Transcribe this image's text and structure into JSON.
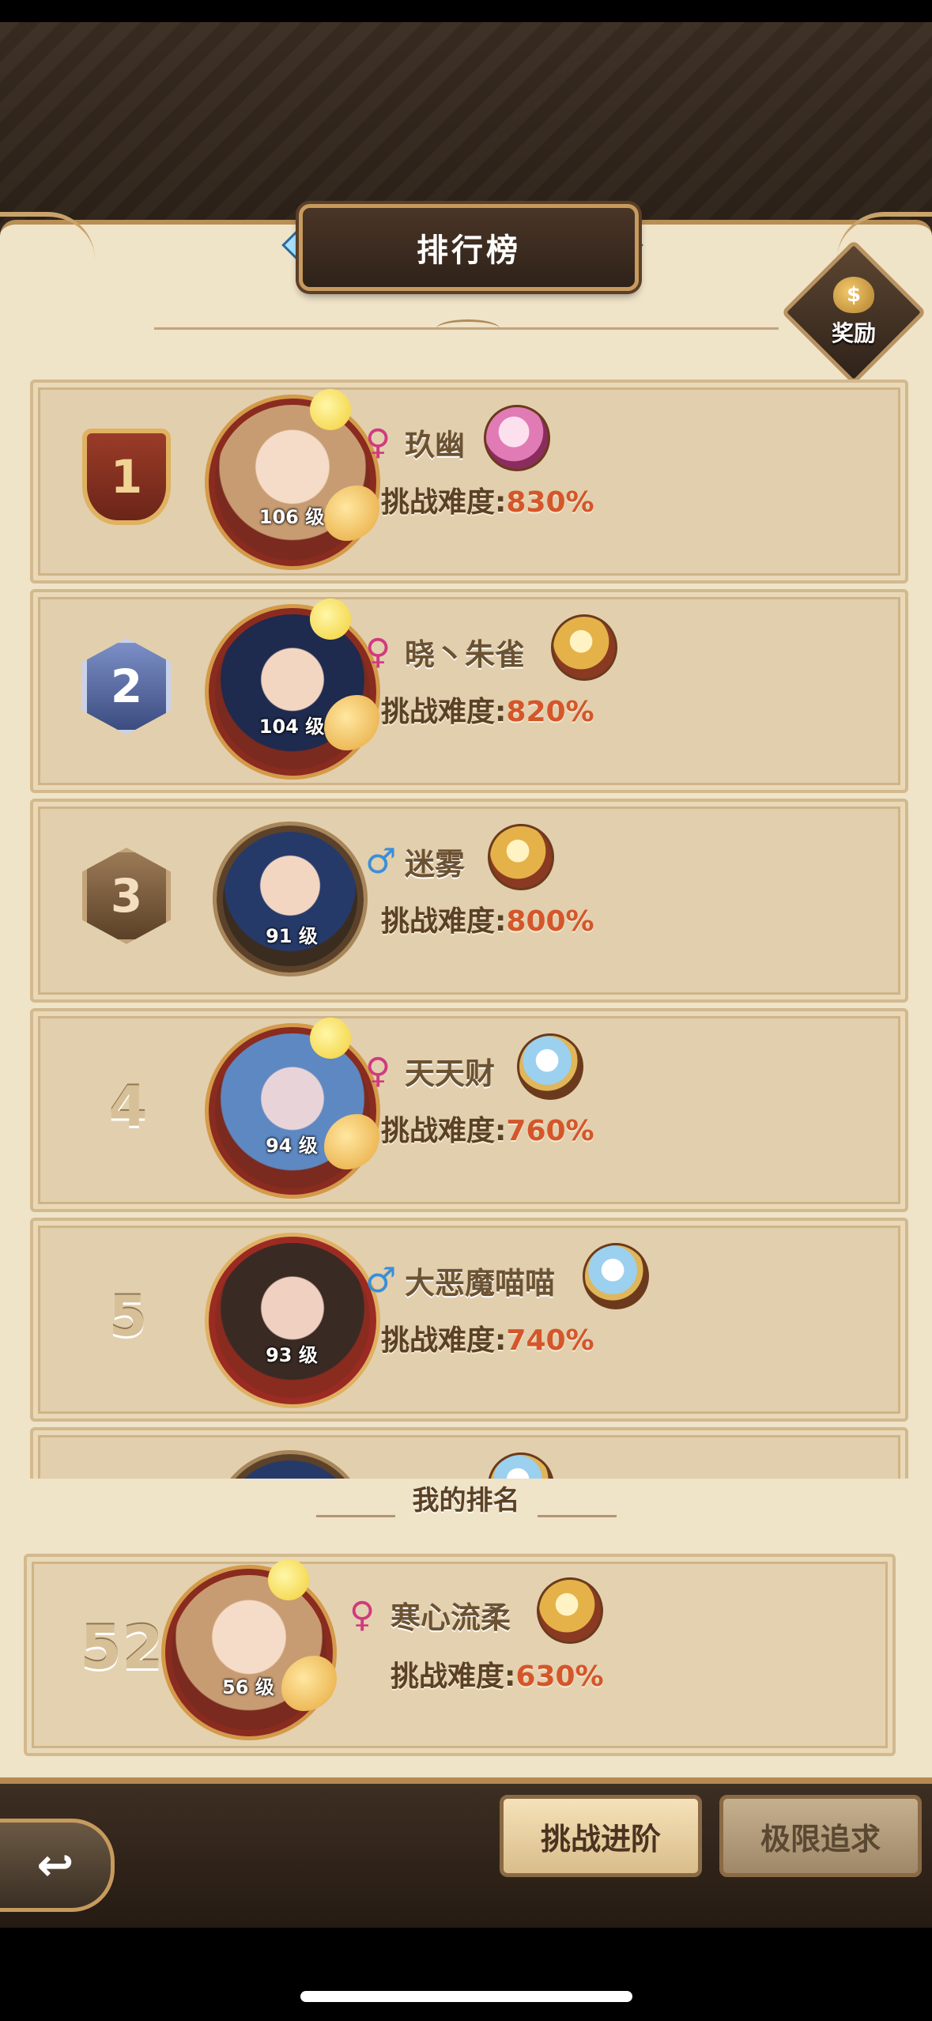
{
  "header": {
    "title": "排行榜"
  },
  "reward": {
    "label": "奖励",
    "icon": "money-bag-icon",
    "icon_glyph": "$"
  },
  "ranking": [
    {
      "rank": "1",
      "gender": "female",
      "gender_glyph": "♀",
      "name": "玖幽",
      "level": "106 级",
      "difficulty_label": "挑战难度:",
      "difficulty_value": "830%"
    },
    {
      "rank": "2",
      "gender": "female",
      "gender_glyph": "♀",
      "name": "晓丶朱雀",
      "level": "104 级",
      "difficulty_label": "挑战难度:",
      "difficulty_value": "820%"
    },
    {
      "rank": "3",
      "gender": "male",
      "gender_glyph": "♂",
      "name": "迷雾",
      "level": "91 级",
      "difficulty_label": "挑战难度:",
      "difficulty_value": "800%"
    },
    {
      "rank": "4",
      "gender": "female",
      "gender_glyph": "♀",
      "name": "天天财",
      "level": "94 级",
      "difficulty_label": "挑战难度:",
      "difficulty_value": "760%"
    },
    {
      "rank": "5",
      "gender": "male",
      "gender_glyph": "♂",
      "name": "大恶魔喵喵",
      "level": "93 级",
      "difficulty_label": "挑战难度:",
      "difficulty_value": "740%"
    }
  ],
  "my_rank": {
    "header": "我的排名",
    "rank": "52",
    "gender": "female",
    "gender_glyph": "♀",
    "name": "寒心流柔",
    "level": "56 级",
    "difficulty_label": "挑战难度:",
    "difficulty_value": "630%"
  },
  "footer": {
    "back_glyph": "↩",
    "challenge_advance": "挑战进阶",
    "limit_pursuit": "极限追求"
  },
  "colors": {
    "accent": "#d4562a",
    "female": "#d03a7f",
    "male": "#3a8fd8"
  }
}
